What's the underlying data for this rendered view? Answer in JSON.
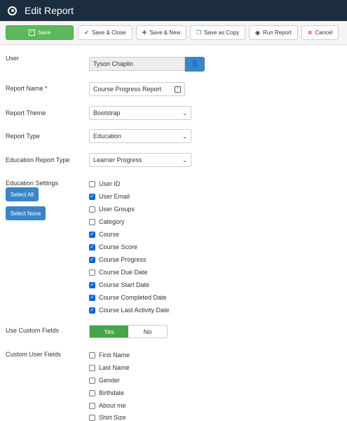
{
  "header": {
    "title": "Edit Report",
    "logo_icon": "joomla-logo-icon"
  },
  "toolbar": {
    "save": "Save",
    "save_close": "Save & Close",
    "save_new": "Save & New",
    "save_copy": "Save as Copy",
    "run_report": "Run Report",
    "cancel": "Cancel"
  },
  "form": {
    "user_label": "User",
    "user_value": "Tyson Chaplin",
    "report_name_label": "Report Name *",
    "report_name_value": "Course Progress Report",
    "report_theme_label": "Report Theme",
    "report_theme_value": "Bootstrap",
    "report_type_label": "Report Type",
    "report_type_value": "Education",
    "education_report_type_label": "Education Report Type",
    "education_report_type_value": "Learner Progress",
    "education_settings_label": "Education Settings",
    "select_all": "Select All",
    "select_none": "Select None",
    "education_settings": [
      {
        "label": "User ID",
        "checked": false
      },
      {
        "label": "User Email",
        "checked": true
      },
      {
        "label": "User Groups",
        "checked": false
      },
      {
        "label": "Category",
        "checked": false
      },
      {
        "label": "Course",
        "checked": true
      },
      {
        "label": "Course Score",
        "checked": true
      },
      {
        "label": "Course Progress",
        "checked": true
      },
      {
        "label": "Course Due Date",
        "checked": false
      },
      {
        "label": "Course Start Date",
        "checked": true
      },
      {
        "label": "Course Completed Date",
        "checked": true
      },
      {
        "label": "Course Last Activity Date",
        "checked": true
      }
    ],
    "use_custom_fields_label": "Use Custom Fields",
    "use_custom_fields_yes": "Yes",
    "use_custom_fields_no": "No",
    "use_custom_fields_selected": "Yes",
    "custom_user_fields_label": "Custom User Fields",
    "custom_user_fields": [
      {
        "label": "First Name",
        "checked": false
      },
      {
        "label": "Last Name",
        "checked": false
      },
      {
        "label": "Gender",
        "checked": false
      },
      {
        "label": "Birthdate",
        "checked": false
      },
      {
        "label": "About me",
        "checked": false
      },
      {
        "label": "Shirt Size",
        "checked": false
      }
    ]
  },
  "colors": {
    "header_bg": "#1c2d3f",
    "save_green": "#5cb85c",
    "primary_blue": "#3a85c8",
    "toggle_on": "#46a546",
    "checkbox_on": "#0b66d6"
  }
}
